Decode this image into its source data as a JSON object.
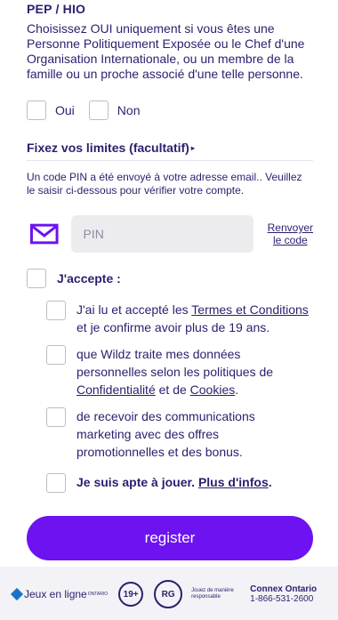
{
  "pep": {
    "title": "PEP / HIO",
    "description": "Choisissez OUI uniquement si vous êtes une Personne Politiquement Exposée ou le Chef d'une Organisation Internationale, ou un membre de la famille ou un proche associé d'une telle personne.",
    "yes_label": "Oui",
    "no_label": "Non"
  },
  "limits": {
    "title": "Fixez vos limites (facultatif)",
    "caret": "▸"
  },
  "pin": {
    "message": "Un code PIN a été envoyé à votre adresse email.. Veuillez le saisir ci-dessous pour vérifier votre compte.",
    "placeholder": "PIN",
    "resend_line1": "Renvoyer",
    "resend_line2": "le code"
  },
  "accept": {
    "label": "J'accepte :",
    "terms_pre": "J'ai lu et accepté les ",
    "terms_link": "Termes et Conditions",
    "terms_post": " et je confirme avoir plus de 19 ans.",
    "privacy_pre": "que Wildz traite mes données personnelles selon les politiques de ",
    "privacy_link1": "Confidentialité",
    "privacy_mid": " et de ",
    "privacy_link2": "Cookies",
    "privacy_post": ".",
    "marketing": "de recevoir des communications marketing avec des offres promotionnelles et des bonus.",
    "fit_pre": "Je suis apte à jouer. ",
    "fit_link": "Plus d'infos",
    "fit_post": "."
  },
  "register_label": "register",
  "footer": {
    "jel_label": "Jeux en ligne",
    "jel_sup": "ONTARIO",
    "age_badge": "19+",
    "rg_badge": "RG",
    "responsible_text": "Jouez de manière responsable",
    "connex_title": "Connex Ontario",
    "connex_phone": "1-866-531-2600"
  },
  "colors": {
    "primary": "#6d12f0",
    "text": "#2b1f6e",
    "input_bg": "#ececee"
  },
  "icons": {
    "mail": "mail-icon"
  }
}
